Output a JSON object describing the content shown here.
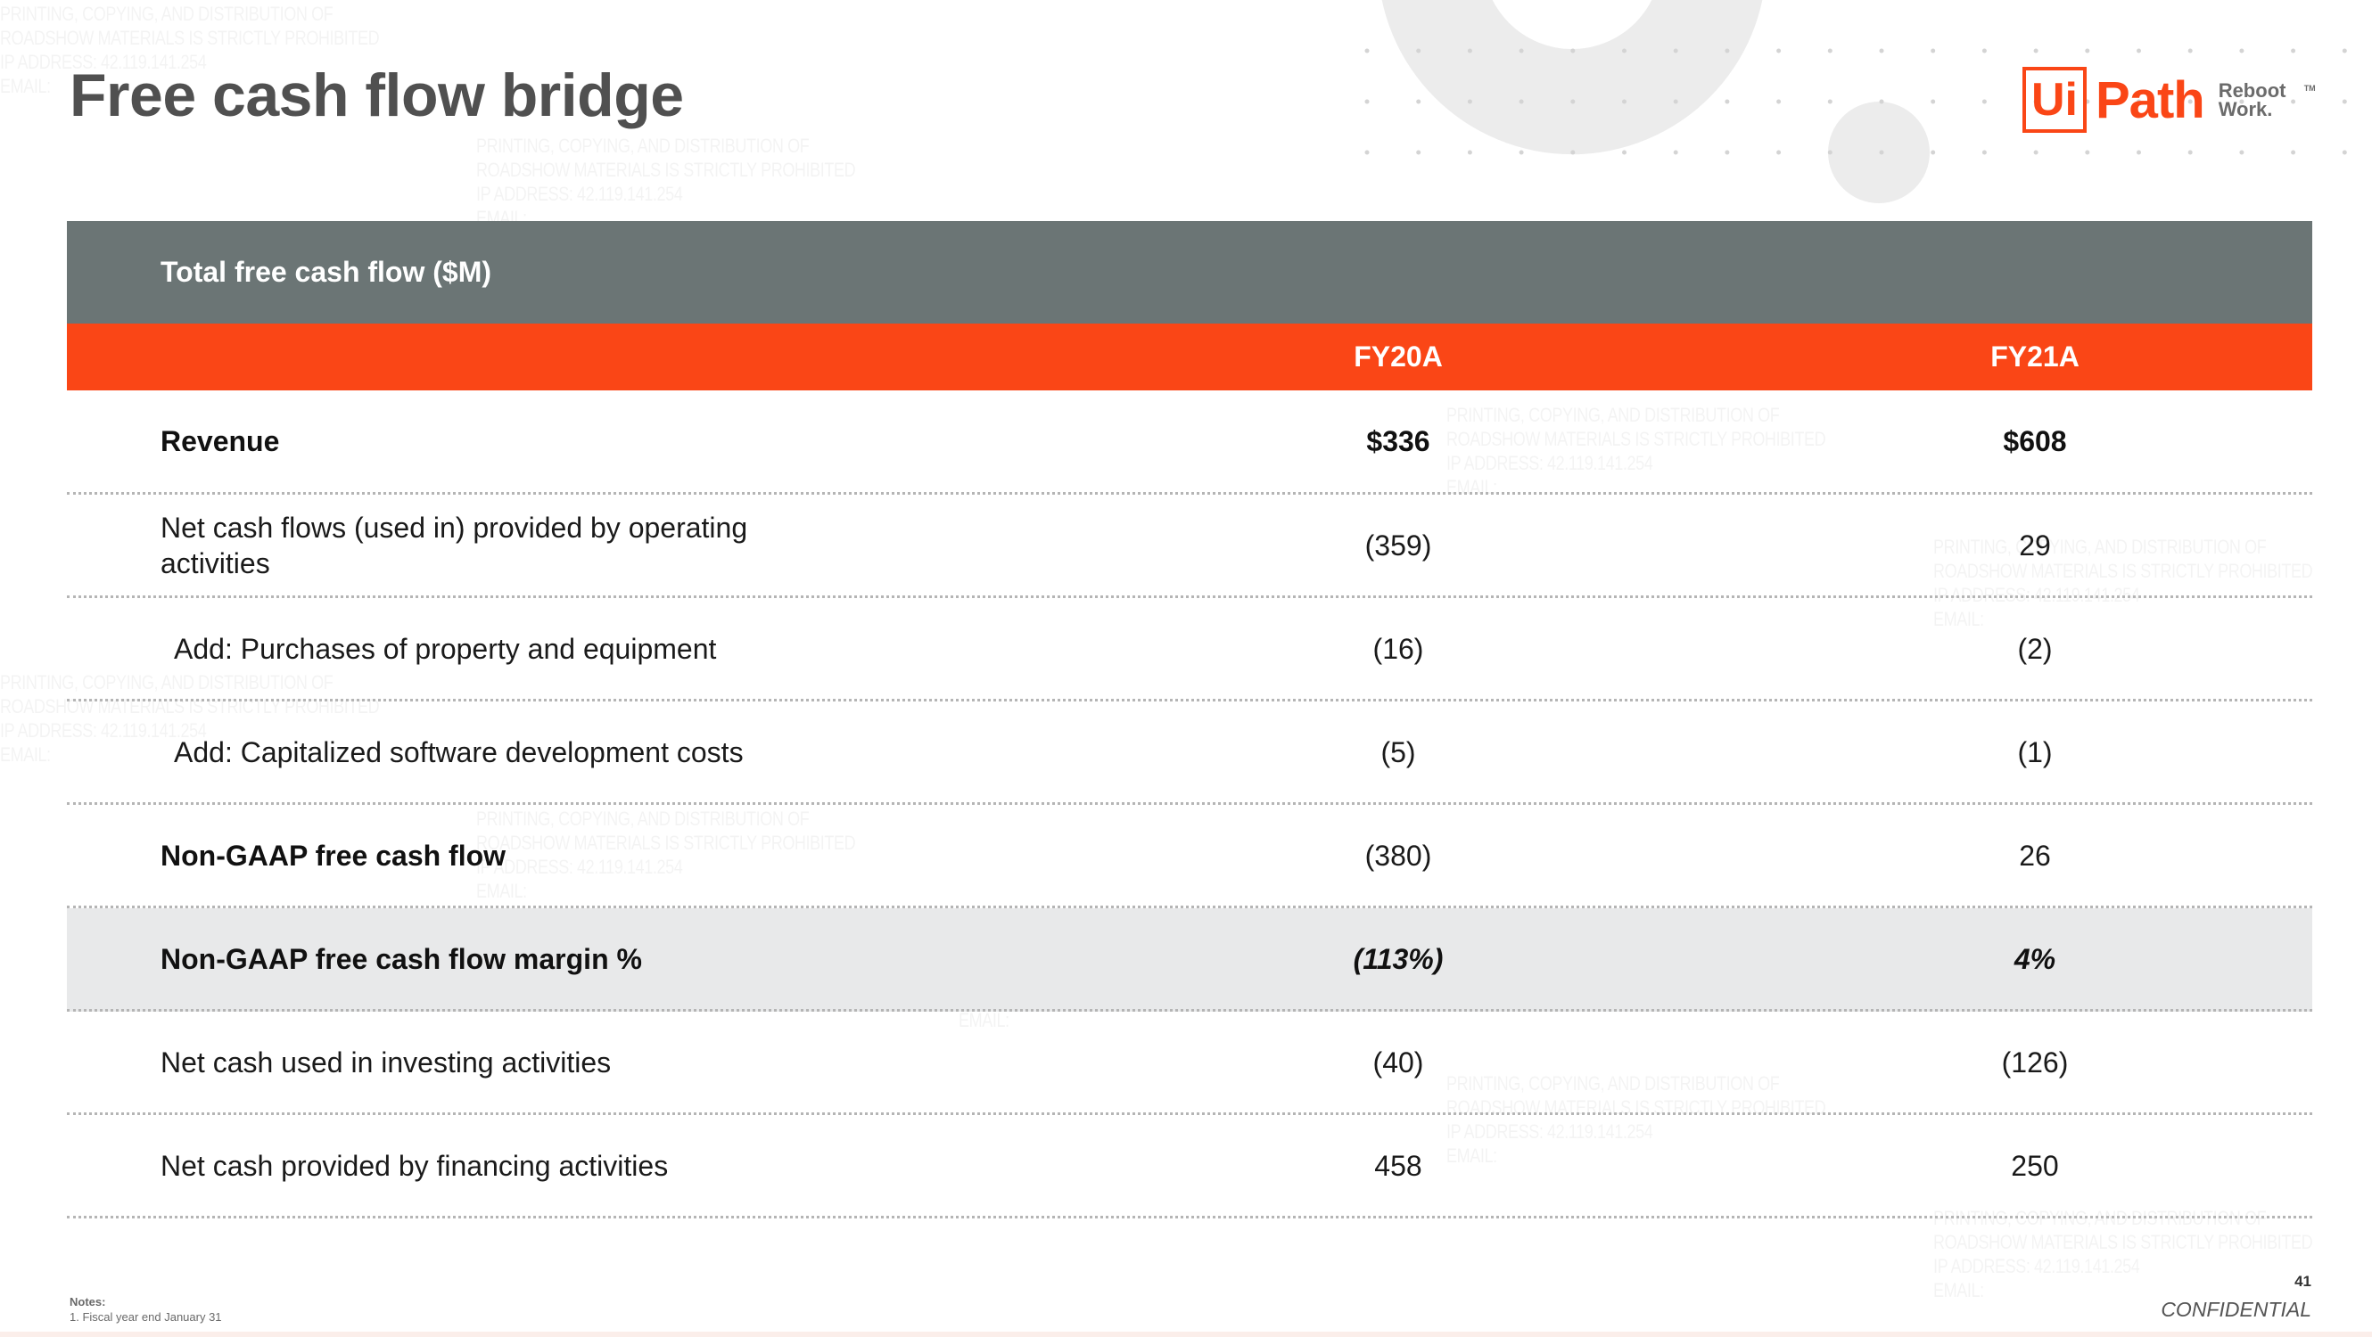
{
  "page": {
    "title": "Free cash flow bridge",
    "page_number": "41",
    "confidential_label": "CONFIDENTIAL"
  },
  "logo": {
    "box_text": "Ui",
    "wordmark": "Path",
    "tagline_line1": "Reboot",
    "tagline_line2": "Work.",
    "trademark": "TM",
    "brand_color": "#fa4616"
  },
  "colors": {
    "header_gray": "#6b7575",
    "header_orange": "#fa4616",
    "shaded_row": "#e8e9ea"
  },
  "table": {
    "caption": "Total free cash flow ($M)",
    "columns": [
      "FY20A",
      "FY21A"
    ],
    "rows": [
      {
        "label": "Revenue",
        "values": [
          "$336",
          "$608"
        ],
        "style": "bold"
      },
      {
        "label": "Net cash flows (used in) provided by operating activities",
        "values": [
          "(359)",
          "29"
        ],
        "style": "normal"
      },
      {
        "label": "Add: Purchases of property and equipment",
        "values": [
          "(16)",
          "(2)"
        ],
        "style": "indent"
      },
      {
        "label": "Add: Capitalized software development costs",
        "values": [
          "(5)",
          "(1)"
        ],
        "style": "indent"
      },
      {
        "label": "Non-GAAP free cash flow",
        "values": [
          "(380)",
          "26"
        ],
        "style": "bold-label"
      },
      {
        "label": "Non-GAAP free cash flow margin %",
        "values": [
          "(113%)",
          "4%"
        ],
        "style": "shaded"
      },
      {
        "label": "Net cash used in investing activities",
        "values": [
          "(40)",
          "(126)"
        ],
        "style": "normal"
      },
      {
        "label": "Net cash provided by financing activities",
        "values": [
          "458",
          "250"
        ],
        "style": "normal"
      }
    ]
  },
  "notes": {
    "heading": "Notes:",
    "items": [
      "1. Fiscal year end January 31"
    ]
  },
  "watermark": {
    "line1": "PRINTING, COPYING, AND DISTRIBUTION OF",
    "line2": "ROADSHOW MATERIALS IS STRICTLY PROHIBITED",
    "line3": "IP ADDRESS: 42.119.141.254",
    "line4": "EMAIL:"
  }
}
